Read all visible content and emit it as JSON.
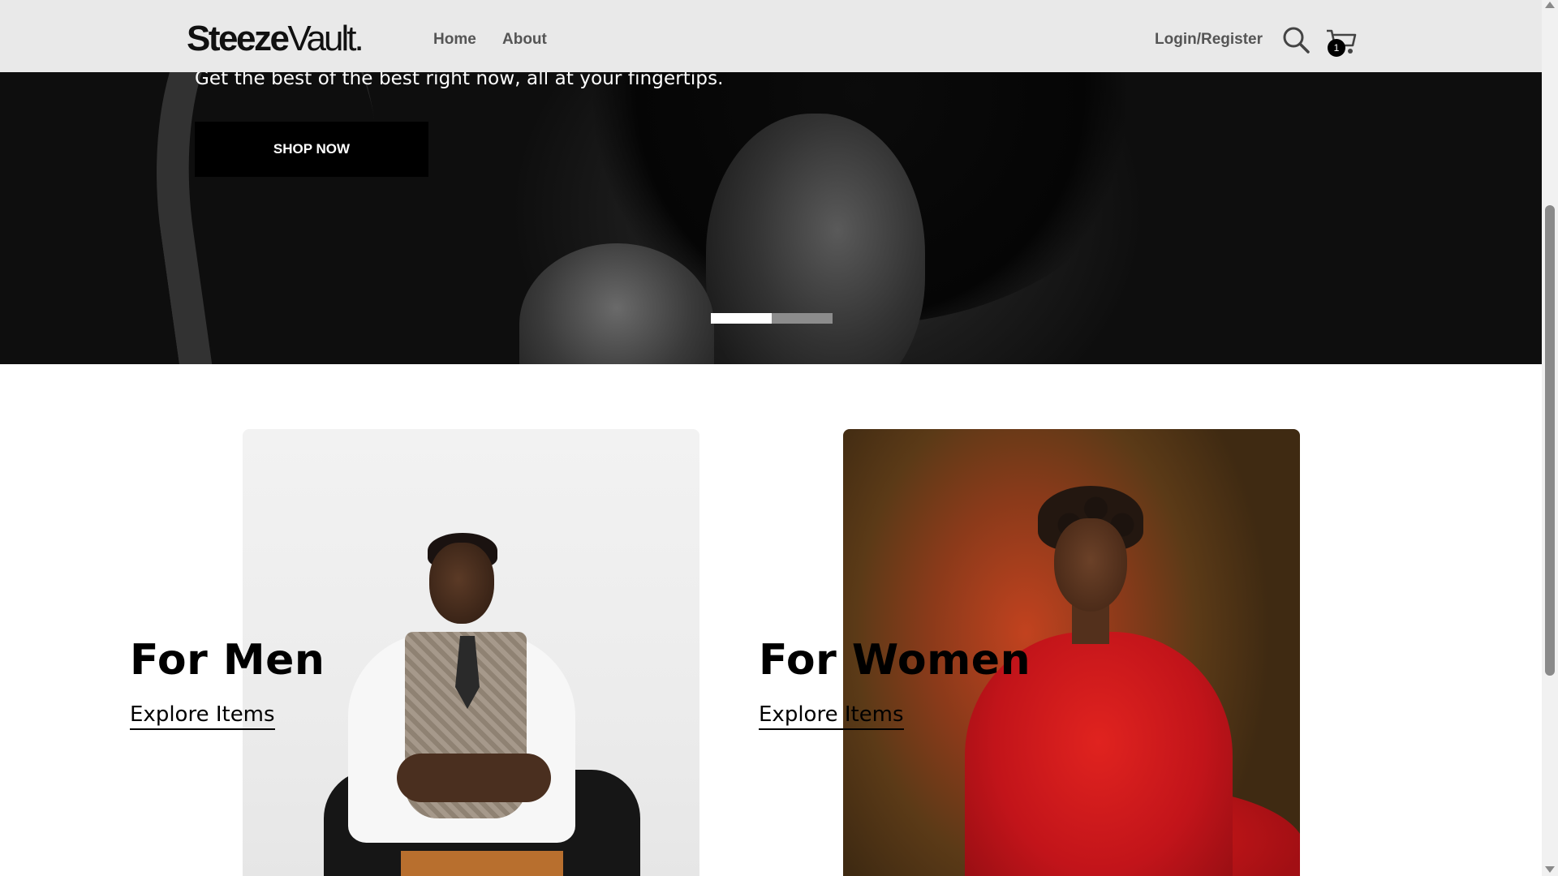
{
  "header": {
    "logo_main": "Steeze",
    "logo_vault": "Vault.",
    "nav": [
      "Home",
      "About"
    ],
    "login_label": "Login/Register",
    "cart_count": "1"
  },
  "hero": {
    "subtitle": "Get the best of the best right now, all at your fingertips.",
    "cta_label": "SHOP NOW",
    "slides_total": 2,
    "active_slide": 1
  },
  "categories": [
    {
      "title": "For Men",
      "link_label": "Explore Items"
    },
    {
      "title": "For Women",
      "link_label": "Explore Items"
    }
  ],
  "icons": {
    "search": "search-icon",
    "cart": "cart-icon"
  },
  "colors": {
    "header_bg": "#e9e9e9",
    "nav_text": "#555555",
    "cta_bg": "#000000",
    "cta_text": "#ffffff",
    "slider_active": "#ffffff",
    "slider_inactive": "#8c8c8c"
  }
}
